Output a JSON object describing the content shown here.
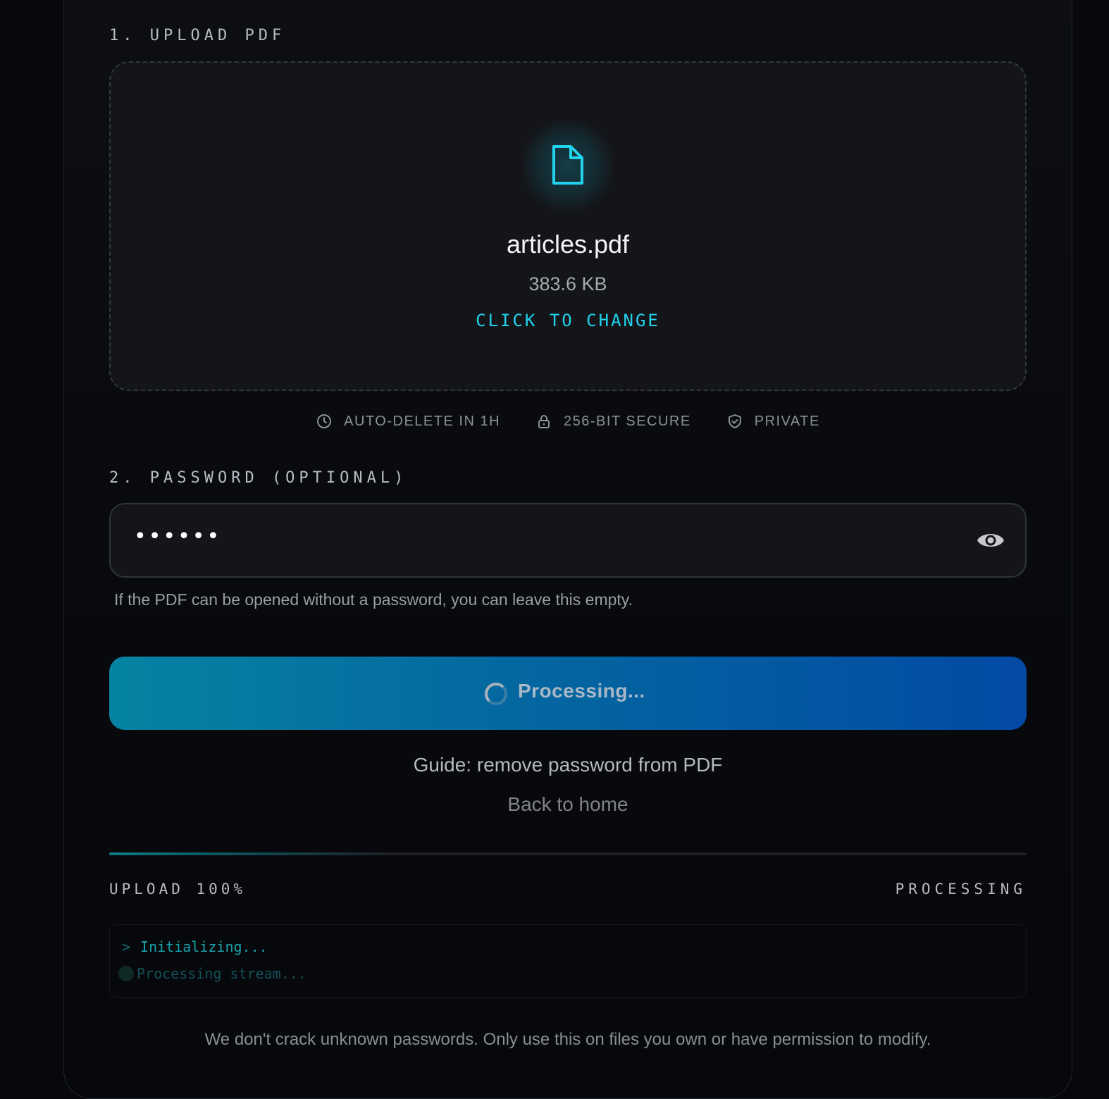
{
  "sections": {
    "upload_label": "1. UPLOAD PDF",
    "password_label": "2. PASSWORD (OPTIONAL)"
  },
  "file": {
    "name": "articles.pdf",
    "size": "383.6 KB",
    "change_label": "CLICK TO CHANGE",
    "icon": "file-icon"
  },
  "badges": [
    {
      "icon": "clock-icon",
      "label": "AUTO-DELETE IN 1H"
    },
    {
      "icon": "lock-icon",
      "label": "256-BIT SECURE"
    },
    {
      "icon": "shield-icon",
      "label": "PRIVATE"
    }
  ],
  "password": {
    "masked_value": "••••••",
    "hint": "If the PDF can be opened without a password, you can leave this empty.",
    "toggle_icon": "eye-icon"
  },
  "action": {
    "button_label": "Processing...",
    "state": "processing"
  },
  "links": {
    "guide": "Guide: remove password from PDF",
    "back": "Back to home"
  },
  "progress": {
    "upload_label": "UPLOAD 100%",
    "status": "PROCESSING",
    "fill_fraction": 0.3
  },
  "console": {
    "prompt": ">",
    "lines": [
      "Initializing...",
      "Processing stream..."
    ]
  },
  "disclaimer": "We don't crack unknown passwords. Only use this on files you own or have permission to modify.",
  "colors": {
    "accent": "#22d3ee",
    "button_start": "#0683a2",
    "button_end": "#034aa5",
    "background": "#07080b"
  }
}
